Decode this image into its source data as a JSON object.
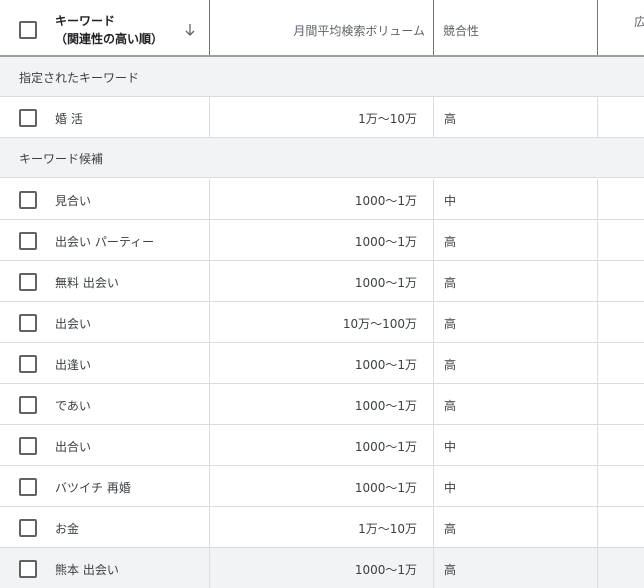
{
  "header": {
    "keyword_label_line1": "キーワード",
    "keyword_label_line2": "（関連性の高い順）",
    "volume_label": "月間平均検索ボリューム",
    "competition_label": "競合性",
    "ad_label_partial": "広"
  },
  "sections": {
    "specified": "指定されたキーワード",
    "candidates": "キーワード候補"
  },
  "specified_rows": [
    {
      "keyword": "婚 活",
      "volume": "1万～10万",
      "competition": "高"
    }
  ],
  "candidate_rows": [
    {
      "keyword": "見合い",
      "volume": "1000～1万",
      "competition": "中"
    },
    {
      "keyword": "出会い パーティー",
      "volume": "1000～1万",
      "competition": "高"
    },
    {
      "keyword": "無料 出会い",
      "volume": "1000～1万",
      "competition": "高"
    },
    {
      "keyword": "出会い",
      "volume": "10万～100万",
      "competition": "高"
    },
    {
      "keyword": "出逢い",
      "volume": "1000～1万",
      "competition": "高"
    },
    {
      "keyword": "であい",
      "volume": "1000～1万",
      "competition": "高"
    },
    {
      "keyword": "出合い",
      "volume": "1000～1万",
      "competition": "中"
    },
    {
      "keyword": "バツイチ 再婚",
      "volume": "1000～1万",
      "competition": "中"
    },
    {
      "keyword": "お金",
      "volume": "1万～10万",
      "competition": "高"
    },
    {
      "keyword": "熊本 出会い",
      "volume": "1000～1万",
      "competition": "高"
    }
  ],
  "icons": {
    "sort": "arrow-down-icon",
    "checkbox": "checkbox-unchecked-icon"
  }
}
